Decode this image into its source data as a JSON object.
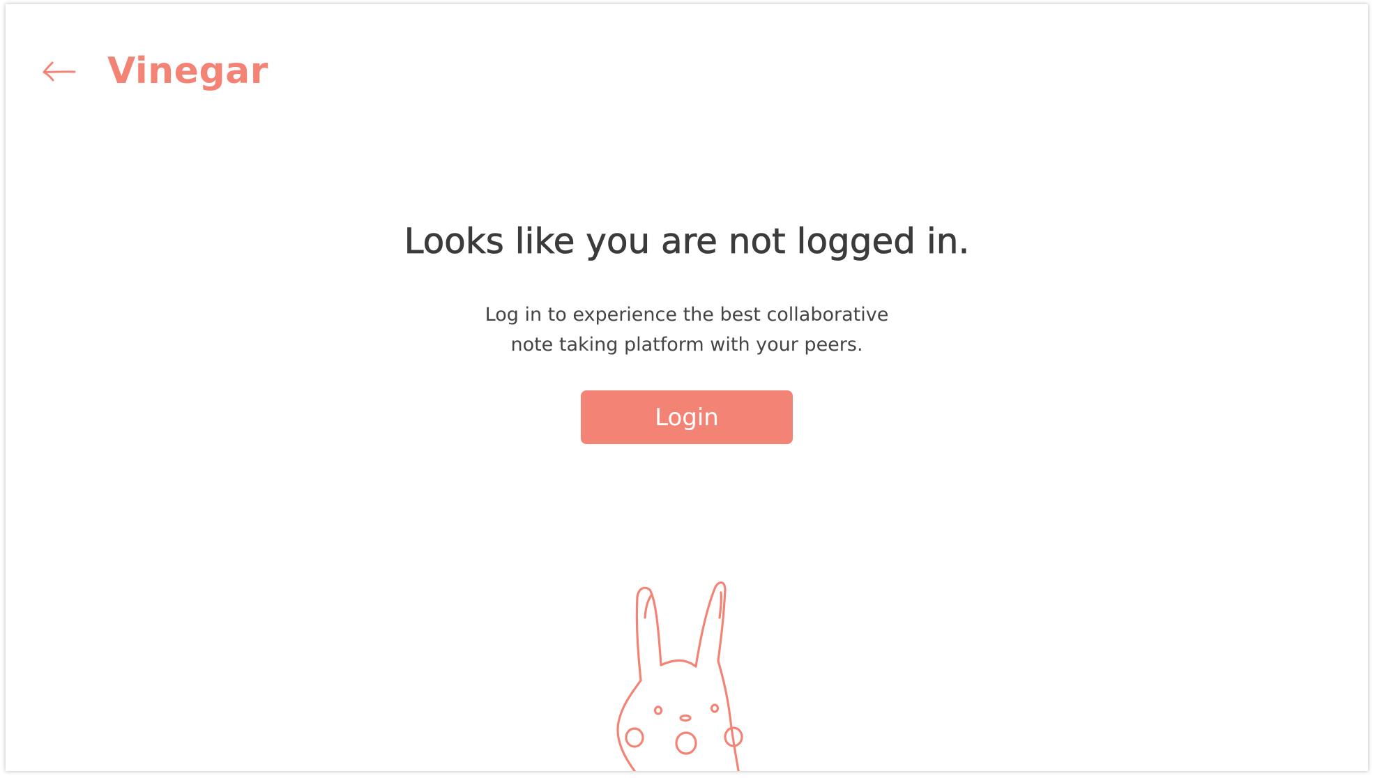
{
  "app": {
    "brand_name": "Vinegar",
    "accent_color": "#f38375"
  },
  "header": {
    "back_icon": "arrow-left-icon"
  },
  "main": {
    "title": "Looks like you are not logged in.",
    "subtitle_line1": "Log in to experience the best collaborative",
    "subtitle_line2": "note taking platform with your peers.",
    "login_label": "Login"
  },
  "illustration": {
    "icon": "bunny-mascot-illustration"
  }
}
